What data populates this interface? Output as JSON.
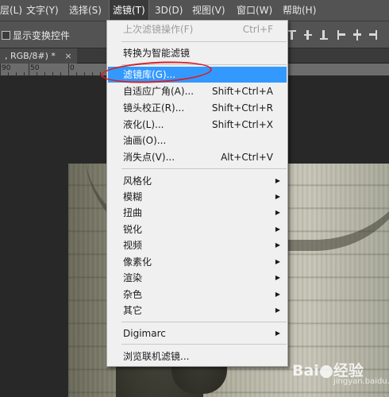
{
  "menubar": {
    "items": [
      {
        "label": "层(L)"
      },
      {
        "label": "文字(Y)"
      },
      {
        "label": "选择(S)"
      },
      {
        "label": "滤镜(T)"
      },
      {
        "label": "3D(D)"
      },
      {
        "label": "视图(V)"
      },
      {
        "label": "窗口(W)"
      },
      {
        "label": "帮助(H)"
      }
    ]
  },
  "options": {
    "show_transform_label": "显示变换控件"
  },
  "document": {
    "tab_label": ", RGB/8#) *",
    "close_symbol": "×"
  },
  "ruler": {
    "labels": [
      "90",
      "50",
      "0"
    ]
  },
  "filter_menu": {
    "items": [
      {
        "label": "上次滤镜操作(F)",
        "shortcut": "Ctrl+F",
        "disabled": true
      },
      {
        "label": "转换为智能滤镜"
      },
      {
        "label": "滤镜库(G)...",
        "highlighted": true
      },
      {
        "label": "自适应广角(A)...",
        "shortcut": "Shift+Ctrl+A"
      },
      {
        "label": "镜头校正(R)...",
        "shortcut": "Shift+Ctrl+R"
      },
      {
        "label": "液化(L)...",
        "shortcut": "Shift+Ctrl+X"
      },
      {
        "label": "油画(O)..."
      },
      {
        "label": "消失点(V)...",
        "shortcut": "Alt+Ctrl+V"
      },
      {
        "label": "风格化",
        "submenu": true
      },
      {
        "label": "模糊",
        "submenu": true
      },
      {
        "label": "扭曲",
        "submenu": true
      },
      {
        "label": "锐化",
        "submenu": true
      },
      {
        "label": "视频",
        "submenu": true
      },
      {
        "label": "像素化",
        "submenu": true
      },
      {
        "label": "渲染",
        "submenu": true
      },
      {
        "label": "杂色",
        "submenu": true
      },
      {
        "label": "其它",
        "submenu": true
      },
      {
        "label": "Digimarc",
        "submenu": true
      },
      {
        "label": "浏览联机滤镜..."
      }
    ],
    "submenu_arrow": "▶"
  },
  "watermark": {
    "brand": "Bai",
    "brand_suffix": "经验",
    "url": "jingyan.baidu.com"
  },
  "colors": {
    "menu_highlight": "#3399ff",
    "annotation": "#d2232a",
    "app_chrome": "#535353"
  }
}
